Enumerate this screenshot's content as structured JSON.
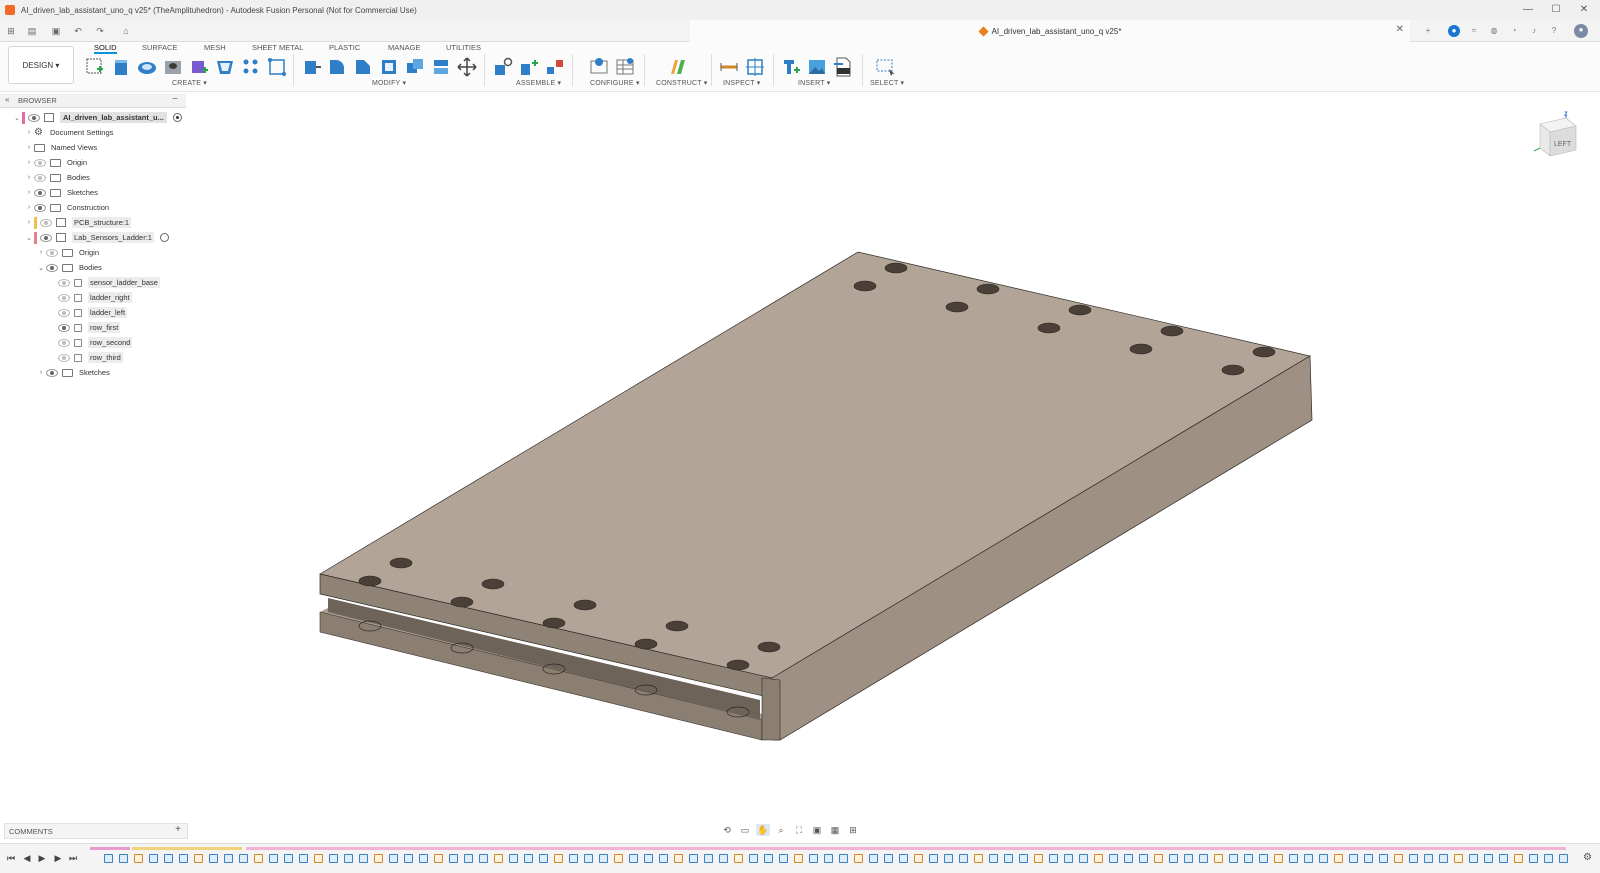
{
  "window": {
    "title": "AI_driven_lab_assistant_uno_q v25* (TheAmplituhedron) - Autodesk Fusion Personal (Not for Commercial Use)",
    "controls": [
      "—",
      "☐",
      "✕"
    ]
  },
  "document_tab": {
    "label": "AI_driven_lab_assistant_uno_q v25*",
    "close": "✕"
  },
  "ribbon": {
    "workspace": "DESIGN",
    "tabs": [
      "SOLID",
      "SURFACE",
      "MESH",
      "SHEET METAL",
      "PLASTIC",
      "MANAGE",
      "UTILITIES"
    ],
    "active_tab": "SOLID",
    "groups": [
      "CREATE",
      "MODIFY",
      "ASSEMBLE",
      "CONFIGURE",
      "CONSTRUCT",
      "INSPECT",
      "INSERT",
      "SELECT"
    ]
  },
  "browser": {
    "title": "BROWSER",
    "collapse": "«",
    "minimize": "−",
    "nodes": [
      {
        "label": "AI_driven_lab_assistant_u...",
        "type": "root"
      },
      {
        "label": "Document Settings",
        "type": "settings"
      },
      {
        "label": "Named Views",
        "type": "folder"
      },
      {
        "label": "Origin",
        "type": "folder"
      },
      {
        "label": "Bodies",
        "type": "folder"
      },
      {
        "label": "Sketches",
        "type": "folder"
      },
      {
        "label": "Construction",
        "type": "folder"
      },
      {
        "label": "PCB_structure:1",
        "type": "component"
      },
      {
        "label": "Lab_Sensors_Ladder:1",
        "type": "component"
      },
      {
        "label": "Origin",
        "type": "folder"
      },
      {
        "label": "Bodies",
        "type": "folder"
      },
      {
        "label": "sensor_ladder_base",
        "type": "body"
      },
      {
        "label": "ladder_right",
        "type": "body"
      },
      {
        "label": "ladder_left",
        "type": "body"
      },
      {
        "label": "row_first",
        "type": "body"
      },
      {
        "label": "row_second",
        "type": "body"
      },
      {
        "label": "row_third",
        "type": "body"
      },
      {
        "label": "Sketches",
        "type": "folder"
      }
    ]
  },
  "viewcube": {
    "face": "LEFT",
    "axis_z": "Z"
  },
  "comments": {
    "title": "COMMENTS",
    "add": "+"
  },
  "navbar": {
    "icons": [
      "orbit-icon",
      "look-at-icon",
      "pan-icon",
      "zoom-icon",
      "fit-icon",
      "display-settings-icon",
      "grid-icon",
      "viewports-icon"
    ]
  },
  "timeline": {
    "controls": [
      "⏮",
      "◀",
      "▶",
      "▶",
      "⏭"
    ],
    "settings": "⚙"
  },
  "colors": {
    "accent": "#0696d7",
    "model_top": "#b2a597",
    "model_side": "#9e9183",
    "model_front": "#8b7f72"
  }
}
